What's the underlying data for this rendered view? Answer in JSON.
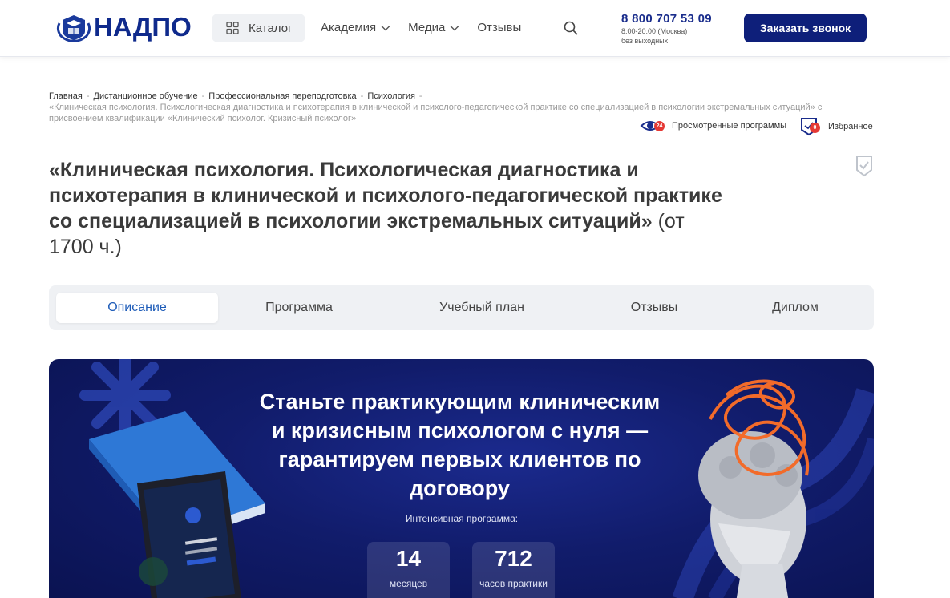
{
  "header": {
    "logo_text": "НАДПО",
    "catalog_label": "Каталог",
    "nav": [
      {
        "label": "Академия",
        "has_dropdown": true
      },
      {
        "label": "Медиа",
        "has_dropdown": true
      },
      {
        "label": "Отзывы",
        "has_dropdown": false
      }
    ],
    "phone": "8 800 707 53 09",
    "hours": "8:00-20:00 (Москва)",
    "days": "без выходных",
    "call_button": "Заказать звонок"
  },
  "breadcrumbs": {
    "items": [
      "Главная",
      "Дистанционное обучение",
      "Профессиональная переподготовка",
      "Психология"
    ],
    "current": "«Клиническая психология. Психологическая диагностика и психотерапия в клинической и психолого-педагогической практике со специализацией в психологии экстремальных ситуаций» с присвоением квалификации «Клинический психолог. Кризисный психолог»"
  },
  "utility": {
    "viewed_label": "Просмотренные программы",
    "viewed_count": "24",
    "favorites_label": "Избранное",
    "favorites_count": "0"
  },
  "page": {
    "title": "«Клиническая психология. Психологическая диагностика и психотерапия в клинической и психолого-педагогической практике со специализацией в психологии экстремальных ситуаций»",
    "hours": "(от 1700 ч.)"
  },
  "tabs": [
    {
      "label": "Описание",
      "active": true
    },
    {
      "label": "Программа",
      "active": false
    },
    {
      "label": "Учебный план",
      "active": false
    },
    {
      "label": "Отзывы",
      "active": false
    },
    {
      "label": "Диплом",
      "active": false
    }
  ],
  "banner": {
    "headline": "Станьте практикующим клиническим и кризисным психологом с нуля — гарантируем первых клиентов по договору",
    "intensive_label": "Интенсивная программа:",
    "stats": [
      {
        "value": "14",
        "label": "месяцев"
      },
      {
        "value": "712",
        "label": "часов практики"
      }
    ]
  },
  "colors": {
    "brand": "#0f2a8c",
    "button": "#0e1f7a",
    "active_tab": "#1d5bb8",
    "badge": "#e53935",
    "banner_bg": "#111c6b",
    "accent_orange": "#f26b2a"
  }
}
